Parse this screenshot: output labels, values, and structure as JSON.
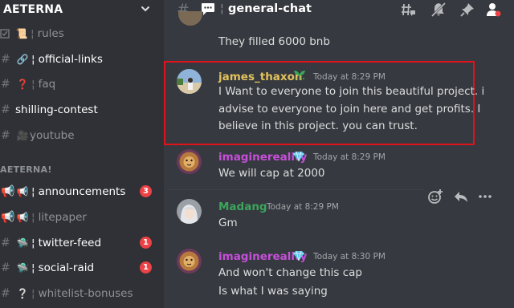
{
  "server": {
    "name": "AETERNA"
  },
  "channels": [
    {
      "emoji": "📜",
      "name": "rules",
      "bright": false
    },
    {
      "emoji": "🔗",
      "name": "official-links",
      "bright": true
    },
    {
      "emoji": "❓",
      "name": "faq",
      "bright": false
    },
    {
      "emoji": "",
      "name": "shilling-contest",
      "bright": true
    },
    {
      "emoji": "🎥",
      "name": "youtube",
      "bright": false
    }
  ],
  "category": "AETERNA!",
  "category_channels": [
    {
      "emoji": "📢",
      "name": "announcements",
      "bright": true,
      "badge": "3"
    },
    {
      "emoji": "📢",
      "name": "litepaper",
      "bright": false,
      "badge": ""
    },
    {
      "emoji": "🛸",
      "name": "twitter-feed",
      "bright": true,
      "badge": "1"
    },
    {
      "emoji": "🛸",
      "name": "social-raid",
      "bright": true,
      "badge": "1"
    },
    {
      "emoji": "❔",
      "name": "whitelist-bonuses",
      "bright": false,
      "badge": ""
    }
  ],
  "channel": {
    "name": "general-chat"
  },
  "messages": [
    {
      "author": "",
      "time": "",
      "lines": [
        "They filled 6000 bnb"
      ]
    },
    {
      "author": "james_thaxon",
      "author_color": "#e3c25c",
      "time": "Today at 8:29 PM",
      "lines": [
        "I Want to everyone to join this beautiful project. i",
        "advise to everyone to join here and get profits. I",
        "believe in this project. you can trust."
      ]
    },
    {
      "author": "imaginereality",
      "author_color": "#c64fd9",
      "time": "Today at 8:29 PM",
      "lines": [
        "We will cap at 2000"
      ]
    },
    {
      "author": "Madang",
      "author_color": "#3ba55c",
      "time": "Today at 8:29 PM",
      "lines": [
        "Gm"
      ]
    },
    {
      "author": "imaginereality",
      "author_color": "#c64fd9",
      "time": "Today at 8:30 PM",
      "lines": [
        "And won't change this cap",
        "Is what I was saying"
      ]
    }
  ],
  "colors": {
    "sidebar": "#2f3136",
    "main": "#36393f",
    "highlight": "#e0121b",
    "badge": "#ed4245"
  }
}
